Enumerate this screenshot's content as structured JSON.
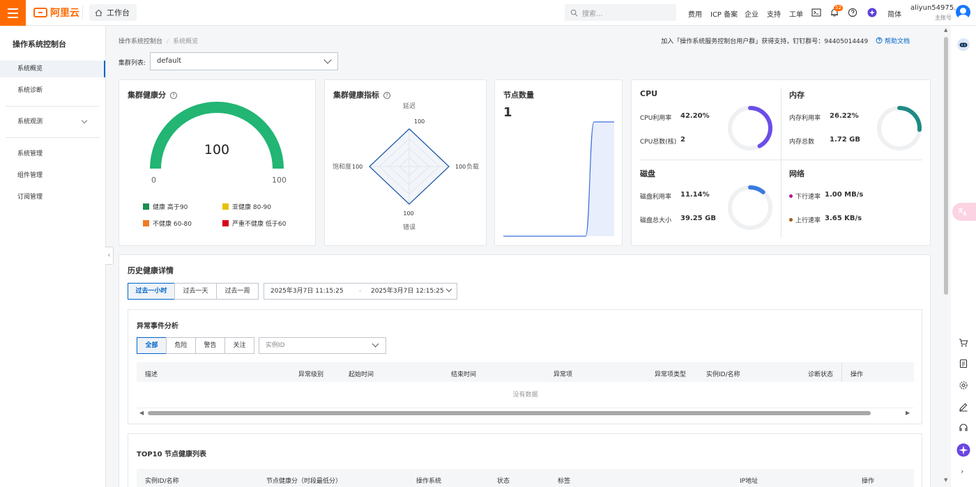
{
  "topbar": {
    "logo_text": "阿里云",
    "workbench_label": "工作台",
    "search_placeholder": "搜索...",
    "nav": [
      "费用",
      "ICP 备案",
      "企业",
      "支持",
      "工单"
    ],
    "notification_count": "52",
    "language": "简体",
    "user_name": "aliyun54975...",
    "user_role": "主账号"
  },
  "sidebar": {
    "title": "操作系统控制台",
    "items": [
      {
        "label": "系统概览",
        "active": true
      },
      {
        "label": "系统诊断"
      },
      {
        "label": "系统观测"
      },
      {
        "label": "系统管理"
      },
      {
        "label": "组件管理"
      },
      {
        "label": "订阅管理"
      }
    ]
  },
  "breadcrumb": {
    "parent": "操作系统控制台",
    "current": "系统概览"
  },
  "help": {
    "text": "加入「操作系统服务控制台用户群」获得支持，钉钉群号：94405014449",
    "doc_label": "帮助文档"
  },
  "cluster": {
    "label": "集群列表:",
    "value": "default"
  },
  "health_score": {
    "title": "集群健康分",
    "value": "100",
    "min": "0",
    "max": "100",
    "fraction": 1.0,
    "legend": [
      {
        "label": "健康 高于90",
        "color": "#1a8f4e"
      },
      {
        "label": "亚健康 80-90",
        "color": "#e8c100"
      },
      {
        "label": "不健康 60-80",
        "color": "#f07b23"
      },
      {
        "label": "严重不健康 低于60",
        "color": "#d9001b"
      }
    ]
  },
  "health_metrics": {
    "title": "集群健康指标",
    "top_label": "延迟",
    "top_value": "100",
    "right_value": "100",
    "right_label": "负载",
    "bottom_value": "100",
    "bottom_label": "错误",
    "left_label": "饱和度",
    "left_value": "100"
  },
  "nodes": {
    "title": "节点数量",
    "value": "1"
  },
  "resources": {
    "cpu": {
      "title": "CPU",
      "usage_label": "CPU利用率",
      "usage_value": "42.20%",
      "usage_fraction": 0.422,
      "total_label": "CPU总数(核)",
      "total_value": "2",
      "color": "#6b4ee8"
    },
    "memory": {
      "title": "内存",
      "usage_label": "内存利用率",
      "usage_value": "26.22%",
      "usage_fraction": 0.2622,
      "total_label": "内存总数",
      "total_value": "1.72 GB",
      "color": "#1f8a84"
    },
    "disk": {
      "title": "磁盘",
      "usage_label": "磁盘利用率",
      "usage_value": "11.14%",
      "usage_fraction": 0.1114,
      "total_label": "磁盘总大小",
      "total_value": "39.25 GB",
      "color": "#3a7be0"
    },
    "network": {
      "title": "网络",
      "down_label": "下行速率",
      "down_value": "1.00 MB/s",
      "down_color": "#b0178f",
      "up_label": "上行速率",
      "up_value": "3.65 KB/s",
      "up_color": "#a4590b"
    }
  },
  "history": {
    "title": "历史健康详情",
    "ranges": [
      "过去一小时",
      "过去一天",
      "过去一周"
    ],
    "start": "2025年3月7日 11:15:25",
    "end": "2025年3月7日 12:15:25",
    "range_sep": "-"
  },
  "events": {
    "title": "异常事件分析",
    "filters": [
      "全部",
      "危险",
      "警告",
      "关注"
    ],
    "instance_placeholder": "实例ID",
    "columns": [
      "描述",
      "异常级别",
      "起始时间",
      "结束时间",
      "异常项",
      "异常项类型",
      "实例ID/名称",
      "诊断状态",
      "操作"
    ],
    "empty": "没有数据"
  },
  "top10": {
    "title": "TOP10 节点健康列表",
    "columns": [
      "实例ID/名称",
      "节点健康分（时段最低分）",
      "操作系统",
      "状态",
      "标签",
      "IP地址",
      "操作"
    ]
  }
}
